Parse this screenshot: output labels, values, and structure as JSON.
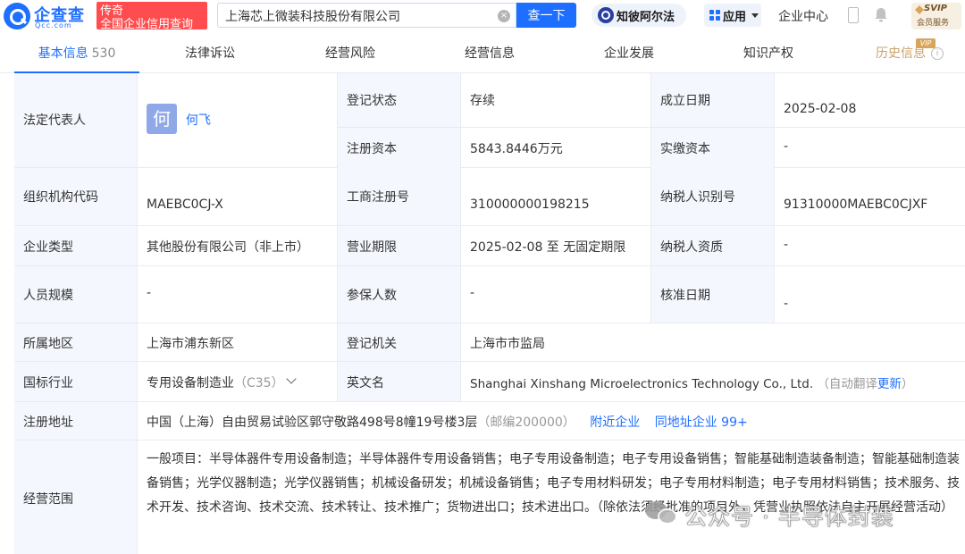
{
  "header": {
    "logo_name": "企查查",
    "logo_domain": "Qcc.com",
    "logo_tag_line1": "传奇",
    "logo_tag_line2": "全国企业信用查询",
    "search_value": "上海芯上微装科技股份有限公司",
    "search_button": "查一下",
    "zhibi_label": "知彼阿尔法",
    "app_label": "应用",
    "enterprise_center": "企业中心",
    "svip_main": "SVIP",
    "svip_sub": "会员服务"
  },
  "tabs": {
    "basic": "基本信息",
    "basic_count": "530",
    "legal": "法律诉讼",
    "risk": "经营风险",
    "operation": "经营信息",
    "development": "企业发展",
    "ip": "知识产权",
    "history": "历史信息",
    "vip_tag": "VIP"
  },
  "info": {
    "legal_rep_label": "法定代表人",
    "legal_rep_avatar": "何",
    "legal_rep_name": "何飞",
    "reg_status_label": "登记状态",
    "reg_status": "存续",
    "found_date_label": "成立日期",
    "found_date": "2025-02-08",
    "reg_capital_label": "注册资本",
    "reg_capital": "5843.8446万元",
    "paid_capital_label": "实缴资本",
    "paid_capital": "-",
    "org_code_label": "组织机构代码",
    "org_code": "MAEBC0CJ-X",
    "biz_reg_no_label": "工商注册号",
    "biz_reg_no": "310000000198215",
    "taxpayer_id_label": "纳税人识别号",
    "taxpayer_id": "91310000MAEBC0CJXF",
    "ent_type_label": "企业类型",
    "ent_type": "其他股份有限公司（非上市）",
    "biz_term_label": "营业期限",
    "biz_term": "2025-02-08 至 无固定期限",
    "taxpayer_qual_label": "纳税人资质",
    "taxpayer_qual": "-",
    "staff_size_label": "人员规模",
    "staff_size": "-",
    "insured_label": "参保人数",
    "insured": "-",
    "approve_date_label": "核准日期",
    "approve_date": "-",
    "region_label": "所属地区",
    "region": "上海市浦东新区",
    "reg_authority_label": "登记机关",
    "reg_authority": "上海市市监局",
    "industry_label": "国标行业",
    "industry": "专用设备制造业",
    "industry_code": "（C35）",
    "en_name_label": "英文名",
    "en_name": "Shanghai Xinshang Microelectronics Technology Co., Ltd.",
    "auto_translate": "（自动翻译",
    "update_link": "更新",
    "auto_translate_end": "）",
    "address_label": "注册地址",
    "address": "中国（上海）自由贸易试验区郭守敬路498号8幢19号楼3层",
    "postcode": "（邮编200000）",
    "nearby_link": "附近企业",
    "same_address_link": "同地址企业 99+",
    "scope_label": "经营范围",
    "scope": "一般项目：半导体器件专用设备制造；半导体器件专用设备销售；电子专用设备制造；电子专用设备销售；智能基础制造装备制造；智能基础制造装备销售；光学仪器制造；光学仪器销售；机械设备研发；机械设备销售；电子专用材料研发；电子专用材料制造；电子专用材料销售；技术服务、技术开发、技术咨询、技术交流、技术转让、技术推广；货物进出口；技术进出口。（除依法须经批准的项目外，凭营业执照依法自主开展经营活动）"
  },
  "watermark": {
    "text": "公众号 · 半导体封装"
  }
}
